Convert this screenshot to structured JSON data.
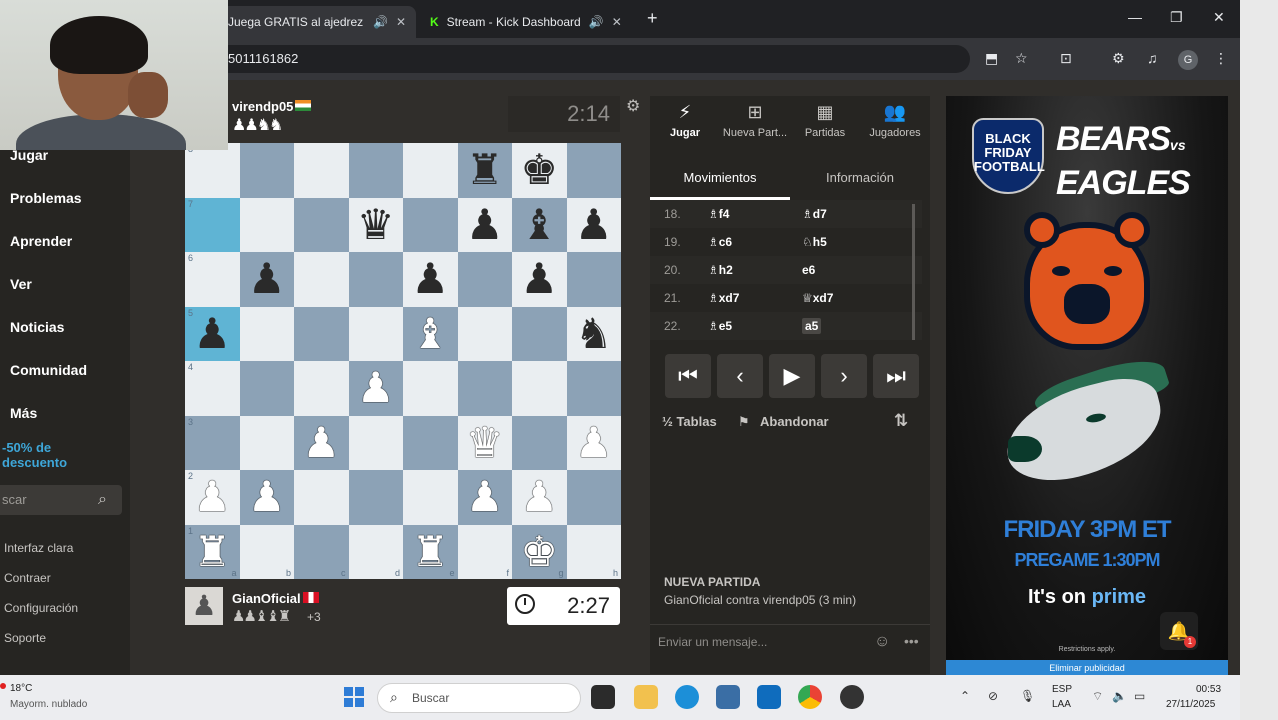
{
  "browser": {
    "tabs": [
      {
        "title": "Juega GRATIS al ajedrez onl",
        "active": true
      },
      {
        "title": "Stream - Kick Dashboard",
        "active": false
      }
    ],
    "url": "5011161862",
    "profile_initial": "G"
  },
  "sidebar": {
    "items": [
      {
        "label": "Jugar"
      },
      {
        "label": "Problemas"
      },
      {
        "label": "Aprender"
      },
      {
        "label": "Ver"
      },
      {
        "label": "Noticias"
      },
      {
        "label": "Comunidad"
      },
      {
        "label": "Más"
      }
    ],
    "discount": "-50% de descuento",
    "search_placeholder": "scar",
    "bottom_links": [
      "Interfaz clara",
      "Contraer",
      "Configuración",
      "Soporte"
    ]
  },
  "opponent": {
    "name": "virendp05",
    "captured": "♟♟♞♞",
    "clock": "2:14",
    "flag_color": "#ef8e26"
  },
  "player": {
    "name": "GianOficial",
    "captured": "♟♟♝♝♜",
    "material_diff": "+3",
    "clock": "2:27",
    "flag_color": "#d91023"
  },
  "board": {
    "ranks": [
      [
        "",
        "",
        "",
        "",
        "",
        "br",
        "bk",
        ""
      ],
      [
        "",
        "",
        "",
        "bq",
        "",
        "bp",
        "bb",
        "bp"
      ],
      [
        "",
        "bp",
        "",
        "",
        "bp",
        "",
        "bp",
        ""
      ],
      [
        "bp",
        "",
        "",
        "",
        "wb",
        "",
        "",
        "bn"
      ],
      [
        "",
        "",
        "",
        "wp",
        "",
        "",
        "",
        ""
      ],
      [
        "",
        "",
        "wp",
        "",
        "",
        "wq",
        "",
        "wp"
      ],
      [
        "wp",
        "wp",
        "",
        "",
        "",
        "wp",
        "wp",
        ""
      ],
      [
        "wr",
        "",
        "",
        "",
        "wr",
        "",
        "wk",
        ""
      ]
    ],
    "highlight": [
      [
        1,
        0
      ],
      [
        3,
        0
      ]
    ],
    "rank_labels": [
      "8",
      "7",
      "6",
      "5",
      "4",
      "3",
      "2",
      "1"
    ],
    "file_labels": [
      "a",
      "b",
      "c",
      "d",
      "e",
      "f",
      "g",
      "h"
    ],
    "light_color": "#eaeef1",
    "dark_color": "#8ca2b6"
  },
  "panel": {
    "tabs": [
      {
        "label": "Jugar",
        "icon": "lightning-icon",
        "glyph": "⚡"
      },
      {
        "label": "Nueva Part...",
        "icon": "plus-square-icon",
        "glyph": "⊞"
      },
      {
        "label": "Partidas",
        "icon": "board-icon",
        "glyph": "▦"
      },
      {
        "label": "Jugadores",
        "icon": "people-icon",
        "glyph": "👥"
      }
    ],
    "subtabs": [
      "Movimientos",
      "Información"
    ],
    "moves": [
      {
        "num": "18.",
        "white": "♗f4",
        "black": "♗d7"
      },
      {
        "num": "19.",
        "white": "♗c6",
        "black": "♘h5"
      },
      {
        "num": "20.",
        "white": "♗h2",
        "black": "e6"
      },
      {
        "num": "21.",
        "white": "♗xd7",
        "black": "♕xd7"
      },
      {
        "num": "22.",
        "white": "♗e5",
        "black": "a5"
      }
    ],
    "nav_glyphs": [
      "⏮",
      "‹",
      "▶",
      "›",
      "⏭"
    ],
    "draw_label": "½ Tablas",
    "resign_label": "Abandonar",
    "new_game_title": "NUEVA PARTIDA",
    "new_game_desc": "GianOficial contra virendp05 (3 min)",
    "chat_placeholder": "Enviar un mensaje..."
  },
  "ad": {
    "badge": "BLACK FRIDAY FOOTBALL",
    "headline_1": "BEARS",
    "headline_vs": "vs",
    "headline_2": "EAGLES",
    "time": "FRIDAY 3PM ET",
    "pregame": "PREGAME 1:30PM",
    "prime_prefix": "It's on ",
    "prime_word": "prime",
    "fine_print": "Restrictions apply.",
    "bell_count": "1",
    "remove": "Eliminar publicidad"
  },
  "taskbar": {
    "weather_temp": "18°C",
    "weather_desc": "Mayorm. nublado",
    "search_label": "Buscar",
    "lang_1": "ESP",
    "lang_2": "LAA",
    "time": "00:53",
    "date": "27/11/2025"
  }
}
